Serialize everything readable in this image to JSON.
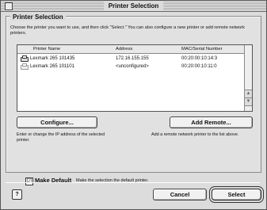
{
  "window": {
    "title": "Printer Selection"
  },
  "group": {
    "title": "Printer Selection",
    "description": "Choose the printer you want to use, and then click \"Select.\" You can also configure a new printer or add remote network printers."
  },
  "table": {
    "headers": [
      "Printer Name",
      "Address",
      "MAC/Serial Number"
    ],
    "rows": [
      {
        "name": "Lexmark 265 101435",
        "address": "172.16.155.155",
        "mac": "00:20:00:10:14:3"
      },
      {
        "name": "Lexmark 265 101101",
        "address": "<unconfigured>",
        "mac": "00:20:00:10:11:0"
      }
    ]
  },
  "configure": {
    "label": "Configure...",
    "help": "Enter or change the IP address of the selected printer."
  },
  "add_remote": {
    "label": "Add Remote...",
    "help": "Add a remote network printer to the list above."
  },
  "make_default": {
    "label": "Make Default",
    "checked_glyph": "☑",
    "description": "Make the selection the default printer."
  },
  "footer": {
    "cancel_label": "Cancel",
    "select_label": "Select",
    "help_glyph": "?"
  },
  "colors": {
    "window_bg": "#dcdcdc",
    "list_bg": "#ffffff"
  }
}
